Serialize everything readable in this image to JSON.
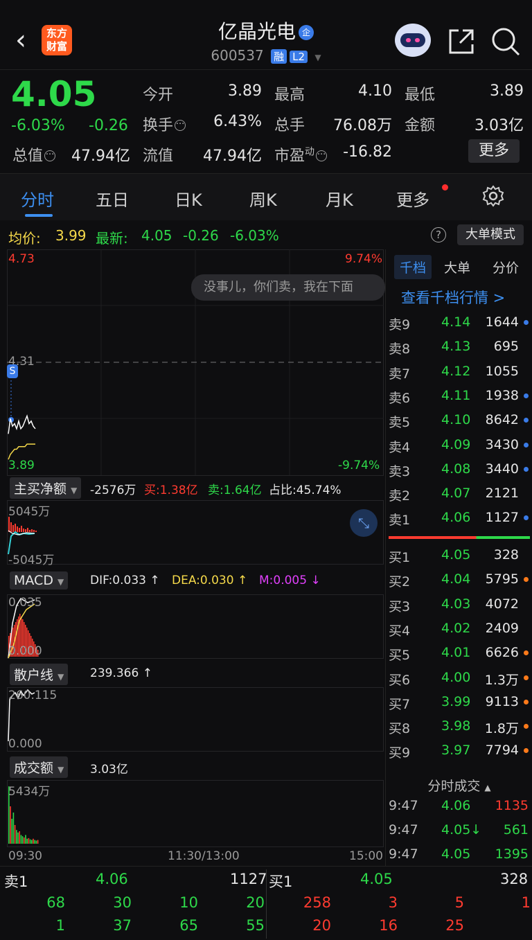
{
  "header": {
    "back_glyph": "‹",
    "logo_text_1": "东方",
    "logo_text_2": "财富",
    "title": "亿晶光电",
    "title_badge": "企",
    "code": "600537",
    "badge_rong": "融",
    "badge_l2": "L2"
  },
  "quote": {
    "price": "4.05",
    "change_pct": "-6.03%",
    "change_abs": "-0.26",
    "open_label": "今开",
    "open": "3.89",
    "high_label": "最高",
    "high": "4.10",
    "low_label": "最低",
    "low": "3.89",
    "turnover_label": "换手",
    "turnover": "6.43%",
    "volume_label": "总手",
    "volume": "76.08万",
    "amount_label": "金额",
    "amount": "3.03亿",
    "mktcap_label": "总值",
    "mktcap": "47.94亿",
    "float_label": "流值",
    "float": "47.94亿",
    "pe_label": "市盈",
    "pe_sup": "动",
    "pe": "-16.82",
    "more": "更多"
  },
  "tabs": [
    "分时",
    "五日",
    "日K",
    "周K",
    "月K",
    "更多"
  ],
  "avg": {
    "avg_label": "均价:",
    "avg": "3.99",
    "latest_label": "最新:",
    "latest": "4.05",
    "chg": "-0.26",
    "pct": "-6.03%",
    "help": "?",
    "big_order_mode": "大单模式"
  },
  "chart": {
    "price_top": "4.73",
    "pct_top": "9.74%",
    "prev_close": "4.31",
    "price_bottom": "3.89",
    "pct_bottom": "-9.74%",
    "s_marker": "S",
    "bubble": "没事儿，你们卖，我在下面",
    "flow": {
      "label": "主买净额",
      "net": "-2576万",
      "buy_label": "买:",
      "buy": "1.38亿",
      "sell_label": "卖:",
      "sell": "1.64亿",
      "ratio_label": "占比:",
      "ratio": "45.74%",
      "top": "5045万",
      "bottom": "-5045万"
    },
    "macd": {
      "label": "MACD",
      "dif": "DIF:0.033 ↑",
      "dea": "DEA:0.030 ↑",
      "m": "M:0.005 ↓",
      "top": "0.035",
      "bottom": "0.000"
    },
    "retail": {
      "label": "散户线",
      "value": "239.366 ↑",
      "top": "260.115",
      "bottom": "0.000"
    },
    "amount": {
      "label": "成交额",
      "value": "3.03亿",
      "top": "5434万"
    },
    "time_start": "09:30",
    "time_mid": "11:30/13:00",
    "time_end": "15:00",
    "colors": {
      "price": "#ffffff",
      "avg": "#f5d94a",
      "up": "#ff3b30",
      "down": "#2ed94a",
      "cyan": "#35d0d6"
    },
    "series": {
      "price": [
        4.03,
        4.09,
        4.06,
        4.07,
        4.05,
        4.08,
        4.05,
        4.06,
        4.08,
        4.1,
        4.07,
        4.08,
        4.06,
        4.05
      ],
      "avg": [
        3.93,
        3.95,
        3.96,
        3.97,
        3.97,
        3.98,
        3.98,
        3.98,
        3.98,
        3.99,
        3.99,
        3.99,
        3.99,
        3.99
      ]
    }
  },
  "book": {
    "tabs": [
      "千档",
      "大单",
      "分价"
    ],
    "view_all": "查看千档行情 >",
    "asks": [
      {
        "label": "卖9",
        "price": "4.14",
        "vol": "1644",
        "dot": "#3a7be8"
      },
      {
        "label": "卖8",
        "price": "4.13",
        "vol": "695",
        "dot": ""
      },
      {
        "label": "卖7",
        "price": "4.12",
        "vol": "1055",
        "dot": ""
      },
      {
        "label": "卖6",
        "price": "4.11",
        "vol": "1938",
        "dot": "#3a7be8"
      },
      {
        "label": "卖5",
        "price": "4.10",
        "vol": "8642",
        "dot": "#3a7be8"
      },
      {
        "label": "卖4",
        "price": "4.09",
        "vol": "3430",
        "dot": "#3a7be8"
      },
      {
        "label": "卖3",
        "price": "4.08",
        "vol": "3440",
        "dot": "#3a7be8"
      },
      {
        "label": "卖2",
        "price": "4.07",
        "vol": "2121",
        "dot": ""
      },
      {
        "label": "卖1",
        "price": "4.06",
        "vol": "1127",
        "dot": "#3a7be8"
      }
    ],
    "bids": [
      {
        "label": "买1",
        "price": "4.05",
        "vol": "328",
        "dot": ""
      },
      {
        "label": "买2",
        "price": "4.04",
        "vol": "5795",
        "dot": "#ff7a1a"
      },
      {
        "label": "买3",
        "price": "4.03",
        "vol": "4072",
        "dot": ""
      },
      {
        "label": "买4",
        "price": "4.02",
        "vol": "2409",
        "dot": ""
      },
      {
        "label": "买5",
        "price": "4.01",
        "vol": "6626",
        "dot": "#ff7a1a"
      },
      {
        "label": "买6",
        "price": "4.00",
        "vol": "1.3万",
        "dot": "#ff7a1a"
      },
      {
        "label": "买7",
        "price": "3.99",
        "vol": "9113",
        "dot": "#ff7a1a"
      },
      {
        "label": "买8",
        "price": "3.98",
        "vol": "1.8万",
        "dot": "#ff7a1a"
      },
      {
        "label": "买9",
        "price": "3.97",
        "vol": "7794",
        "dot": "#ff7a1a"
      }
    ],
    "trade_title": "分时成交",
    "trades": [
      {
        "time": "9:47",
        "price": "4.06",
        "vol": "1135",
        "color": "#ff3b30"
      },
      {
        "time": "9:47",
        "price": "4.05↓",
        "vol": "561",
        "color": "#2ed94a"
      },
      {
        "time": "9:47",
        "price": "4.05",
        "vol": "1395",
        "color": "#2ed94a"
      }
    ]
  },
  "bottom": {
    "sell_label": "卖1",
    "sell_price": "4.06",
    "sell_vol": "1127",
    "buy_label": "买1",
    "buy_price": "4.05",
    "buy_vol": "328",
    "sell_queue": [
      "68",
      "30",
      "10",
      "20",
      "1",
      "37",
      "65",
      "55"
    ],
    "buy_queue": [
      "258",
      "3",
      "5",
      "1",
      "20",
      "16",
      "25"
    ]
  }
}
